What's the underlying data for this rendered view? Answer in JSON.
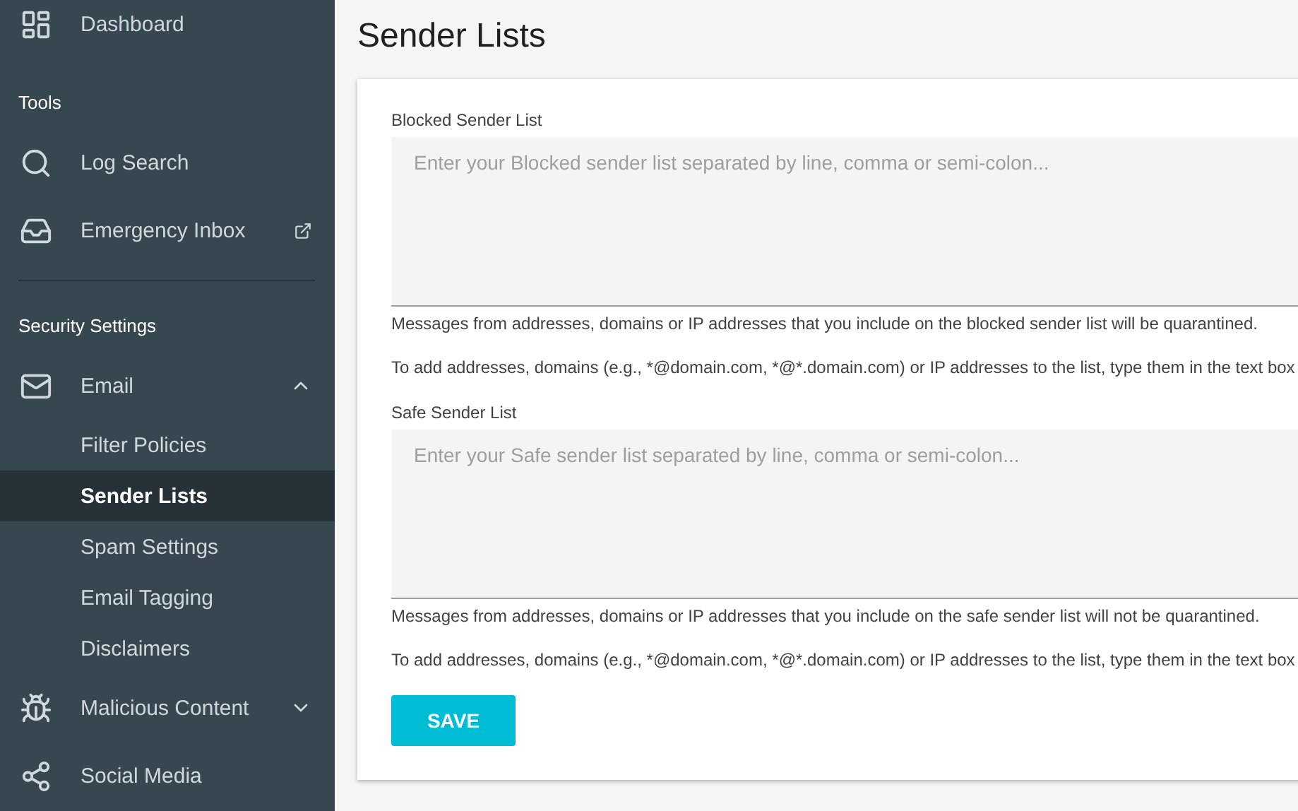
{
  "sidebar": {
    "top_items": [
      {
        "label": "Dashboard"
      }
    ],
    "sections": [
      {
        "title": "Tools",
        "items": [
          {
            "kind": "item",
            "label": "Log Search"
          },
          {
            "kind": "external",
            "label": "Emergency Inbox"
          }
        ]
      },
      {
        "title": "Security Settings",
        "items": [
          {
            "kind": "group",
            "label": "Email",
            "expanded": true,
            "children": [
              {
                "label": "Filter Policies",
                "selected": false
              },
              {
                "label": "Sender Lists",
                "selected": true
              },
              {
                "label": "Spam Settings",
                "selected": false
              },
              {
                "label": "Email Tagging",
                "selected": false
              },
              {
                "label": "Disclaimers",
                "selected": false
              }
            ]
          },
          {
            "kind": "group",
            "label": "Malicious Content",
            "expanded": false
          },
          {
            "kind": "item",
            "label": "Social Media"
          }
        ]
      }
    ]
  },
  "page_title": "Sender Lists",
  "lists": [
    {
      "label": "Blocked Sender List",
      "placeholder": "Enter your Blocked sender list separated by line, comma or semi-colon...",
      "help": "Messages from addresses, domains or IP addresses that you include on the blocked sender list will be quarantined.",
      "instructions": "To add addresses, domains (e.g., *@domain.com, *@*.domain.com) or IP addresses to the list, type them in the text box"
    },
    {
      "label": "Safe Sender List",
      "placeholder": "Enter your Safe sender list separated by line, comma or semi-colon...",
      "help": "Messages from addresses, domains or IP addresses that you include on the safe sender list will not be quarantined.",
      "instructions": "To add addresses, domains (e.g., *@domain.com, *@*.domain.com) or IP addresses to the list, type them in the text box"
    }
  ],
  "save_button": "SAVE"
}
